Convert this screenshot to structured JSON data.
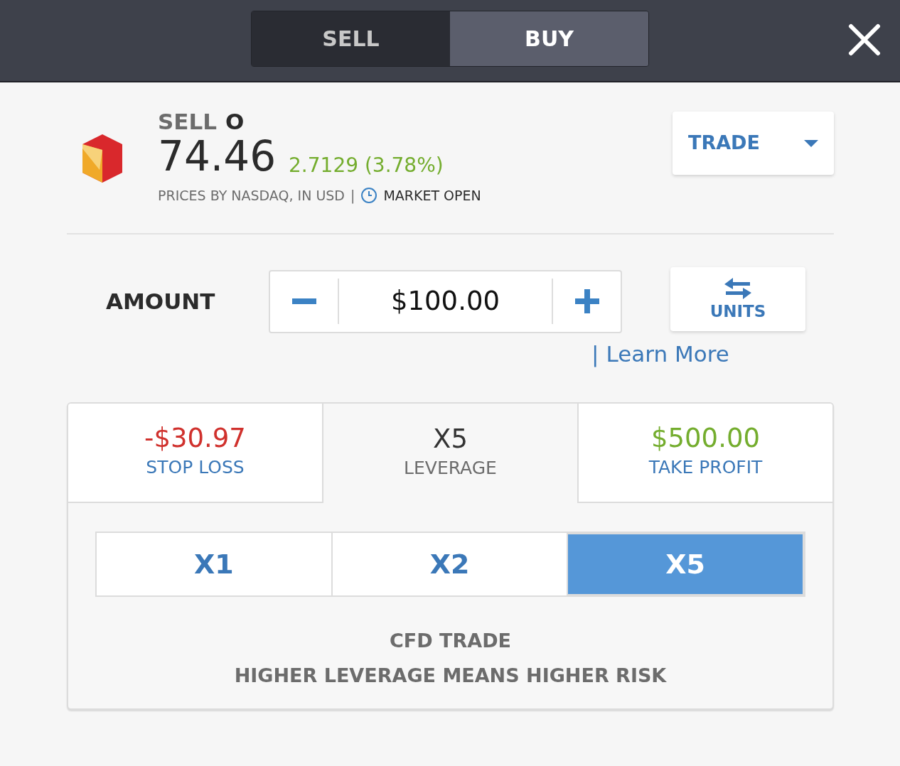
{
  "side_tabs": [
    {
      "label": "SELL",
      "selected": true
    },
    {
      "label": "BUY",
      "selected": false
    }
  ],
  "instrument": {
    "action": "SELL",
    "symbol": "O",
    "price": "74.46",
    "change": "2.7129 (3.78%)",
    "source": "PRICES BY NASDAQ, IN USD",
    "separator": "|",
    "market_status": "MARKET OPEN"
  },
  "mode_dropdown": {
    "value": "TRADE"
  },
  "amount": {
    "label": "AMOUNT",
    "value": "$100.00",
    "units_button": "UNITS",
    "separator": "|",
    "learn_more": "Learn More"
  },
  "settings_tabs": [
    {
      "value": "-$30.97",
      "label": "STOP LOSS",
      "kind": "loss",
      "selected": false
    },
    {
      "value": "X5",
      "label": "LEVERAGE",
      "kind": "neutral",
      "selected": true
    },
    {
      "value": "$500.00",
      "label": "TAKE PROFIT",
      "kind": "profit",
      "selected": false
    }
  ],
  "leverage_options": [
    {
      "label": "X1",
      "selected": false
    },
    {
      "label": "X2",
      "selected": false
    },
    {
      "label": "X5",
      "selected": true
    }
  ],
  "notice": {
    "title": "CFD TRADE",
    "text": "HIGHER LEVERAGE MEANS HIGHER RISK"
  }
}
